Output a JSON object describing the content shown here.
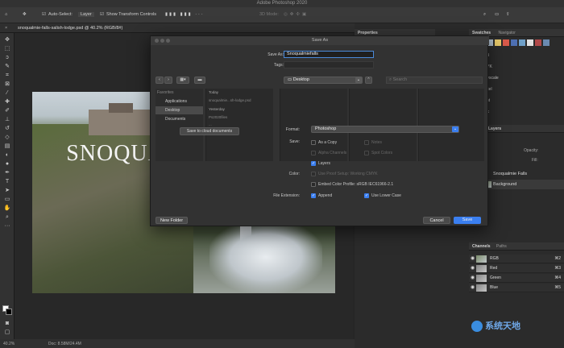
{
  "app": {
    "title": "Adobe Photoshop 2020"
  },
  "options_bar": {
    "auto_select_label": "Auto-Select:",
    "auto_select_value": "Layer",
    "show_transform_label": "Show Transform Controls",
    "mode_3d": "3D Mode:"
  },
  "document": {
    "tab_title": "snoqualmie-falls-salish-lodge.psd @ 40.2% (RGB/8#)",
    "image_title": "SNOQUALMIE FALLS"
  },
  "status": {
    "zoom": "40.2%",
    "doc_size": "Doc: 8.58M/24.4M"
  },
  "right_panel": {
    "properties_tab": "Properties",
    "swatches_tab": "Swatches",
    "navigator_tab": "Navigator",
    "swatch_colors": [
      "#d9d9d9",
      "#c8bfa8",
      "#a9b8c8",
      "#e6c86a",
      "#d85a4a",
      "#4d6fb2",
      "#6fa0c8",
      "#e2e2e2",
      "#b04848",
      "#6a8ab0"
    ],
    "color_modes": [
      "GB",
      "MYK",
      "rayscale",
      "astel",
      "ight",
      "ark"
    ],
    "layers_tab": "Layers",
    "opacity_label": "Opacity:",
    "fill_label": "Fill:",
    "layers": [
      {
        "name": "Snoqualmie Falls"
      },
      {
        "name": "Background"
      }
    ],
    "channels_tab": "Channels",
    "paths_tab": "Paths",
    "channels": [
      {
        "name": "RGB",
        "shortcut": "⌘2"
      },
      {
        "name": "Red",
        "shortcut": "⌘3"
      },
      {
        "name": "Green",
        "shortcut": "⌘4"
      },
      {
        "name": "Blue",
        "shortcut": "⌘5"
      }
    ]
  },
  "dialog": {
    "title": "Save As",
    "save_as_label": "Save As:",
    "save_as_value": "Snoqualmiefalls",
    "tags_label": "Tags:",
    "location": "Desktop",
    "search_placeholder": "Search",
    "favorites_label": "Favorites",
    "sidebar_items": [
      "Applications",
      "Desktop",
      "Documents"
    ],
    "today_label": "Today",
    "today_file": "snoqualmie...sh-lodge.psd",
    "yesterday_label": "Yesterday",
    "yesterday_files": [
      "Ps2020files",
      "...",
      "..."
    ],
    "cloud_button": "Save to cloud documents",
    "format_label": "Format:",
    "format_value": "Photoshop",
    "save_label": "Save:",
    "options": {
      "as_copy": "As a Copy",
      "notes": "Notes",
      "alpha_channels": "Alpha Channels",
      "spot_colors": "Spot Colors",
      "layers": "Layers"
    },
    "color_label": "Color:",
    "use_proof": "Use Proof Setup:  Working CMYK",
    "embed_profile": "Embed Color Profile:  sRGB IEC61966-2.1",
    "file_extension_label": "File Extension:",
    "append": "Append",
    "use_lower_case": "Use Lower Case",
    "new_folder": "New Folder",
    "cancel": "Cancel",
    "save": "Save"
  },
  "watermark": "系统天地"
}
